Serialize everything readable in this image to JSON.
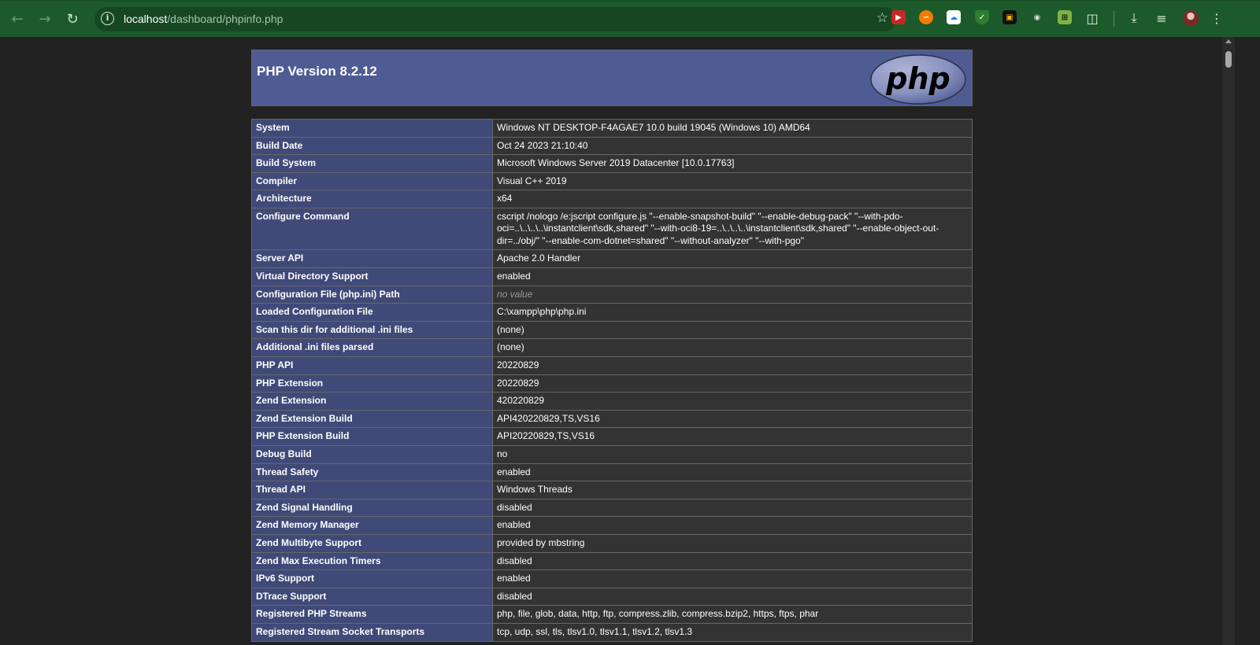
{
  "browser": {
    "url_host": "localhost",
    "url_path": "/dashboard/phpinfo.php"
  },
  "icons": {
    "back": "arrow-left-icon",
    "forward": "arrow-right-icon",
    "reload": "reload-icon",
    "site_info": "info-icon",
    "bookmark": "star-icon",
    "extensions": "puzzle-icon",
    "downloads": "download-icon",
    "media": "media-queue-icon",
    "menu": "kebab-menu-icon"
  },
  "header": {
    "title": "PHP Version 8.2.12",
    "logo_text": "php",
    "bg": "#4f5b93"
  },
  "rows": [
    {
      "key": "System",
      "value": "Windows NT DESKTOP-F4AGAE7 10.0 build 19045 (Windows 10) AMD64"
    },
    {
      "key": "Build Date",
      "value": "Oct 24 2023 21:10:40"
    },
    {
      "key": "Build System",
      "value": "Microsoft Windows Server 2019 Datacenter [10.0.17763]"
    },
    {
      "key": "Compiler",
      "value": "Visual C++ 2019"
    },
    {
      "key": "Architecture",
      "value": "x64"
    },
    {
      "key": "Configure Command",
      "value": "cscript /nologo /e:jscript configure.js \"--enable-snapshot-build\" \"--enable-debug-pack\" \"--with-pdo-oci=..\\..\\..\\..\\instantclient\\sdk,shared\" \"--with-oci8-19=..\\..\\..\\..\\instantclient\\sdk,shared\" \"--enable-object-out-dir=../obj/\" \"--enable-com-dotnet=shared\" \"--without-analyzer\" \"--with-pgo\""
    },
    {
      "key": "Server API",
      "value": "Apache 2.0 Handler"
    },
    {
      "key": "Virtual Directory Support",
      "value": "enabled"
    },
    {
      "key": "Configuration File (php.ini) Path",
      "value": "no value"
    },
    {
      "key": "Loaded Configuration File",
      "value": "C:\\xampp\\php\\php.ini"
    },
    {
      "key": "Scan this dir for additional .ini files",
      "value": "(none)"
    },
    {
      "key": "Additional .ini files parsed",
      "value": "(none)"
    },
    {
      "key": "PHP API",
      "value": "20220829"
    },
    {
      "key": "PHP Extension",
      "value": "20220829"
    },
    {
      "key": "Zend Extension",
      "value": "420220829"
    },
    {
      "key": "Zend Extension Build",
      "value": "API420220829,TS,VS16"
    },
    {
      "key": "PHP Extension Build",
      "value": "API20220829,TS,VS16"
    },
    {
      "key": "Debug Build",
      "value": "no"
    },
    {
      "key": "Thread Safety",
      "value": "enabled"
    },
    {
      "key": "Thread API",
      "value": "Windows Threads"
    },
    {
      "key": "Zend Signal Handling",
      "value": "disabled"
    },
    {
      "key": "Zend Memory Manager",
      "value": "enabled"
    },
    {
      "key": "Zend Multibyte Support",
      "value": "provided by mbstring"
    },
    {
      "key": "Zend Max Execution Timers",
      "value": "disabled"
    },
    {
      "key": "IPv6 Support",
      "value": "enabled"
    },
    {
      "key": "DTrace Support",
      "value": "disabled"
    },
    {
      "key": "Registered PHP Streams",
      "value": "php, file, glob, data, http, ftp, compress.zlib, compress.bzip2, https, ftps, phar"
    },
    {
      "key": "Registered Stream Socket Transports",
      "value": "tcp, udp, ssl, tls, tlsv1.0, tlsv1.1, tlsv1.2, tlsv1.3"
    }
  ]
}
